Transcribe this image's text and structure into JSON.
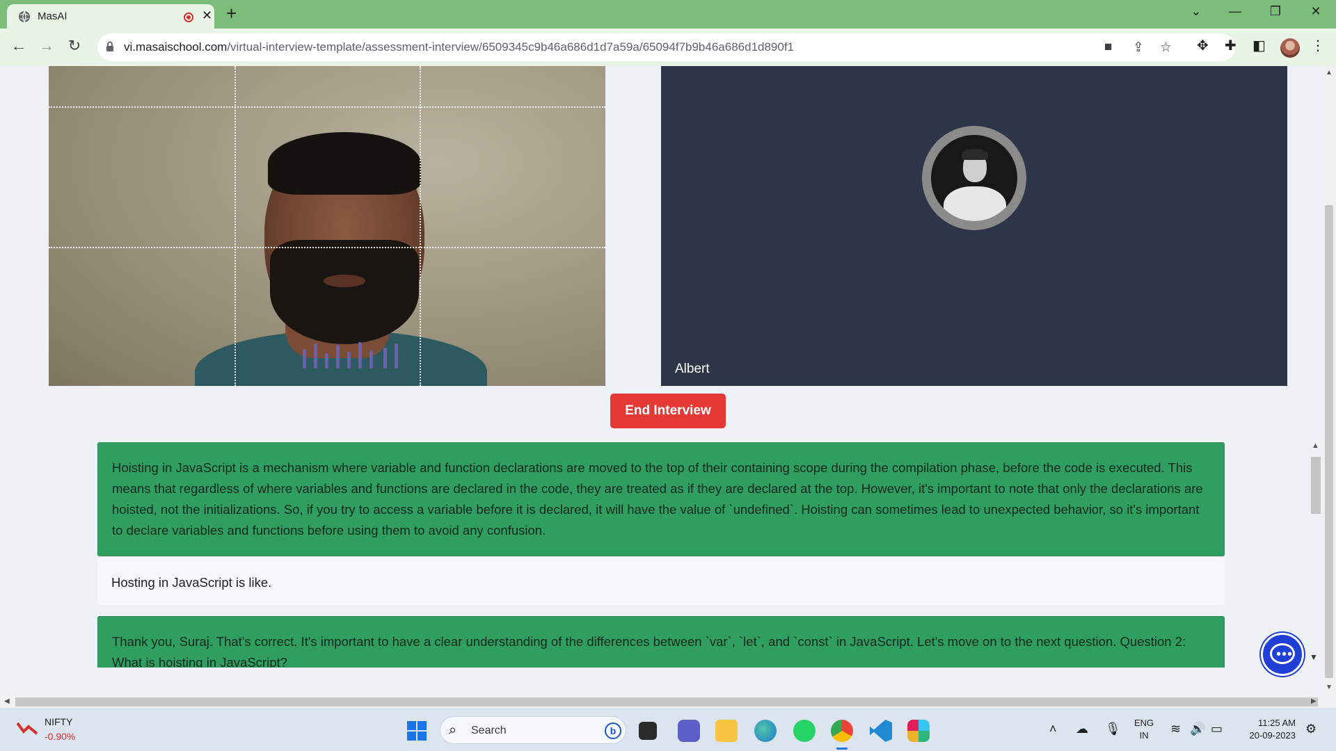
{
  "browser": {
    "tab_title": "MasAI",
    "tab_close": "✕",
    "new_tab": "+",
    "url_host": "vi.masaischool.com",
    "url_path": "/virtual-interview-template/assessment-interview/6509345c9b46a686d1d7a59a/65094f7b9b46a686d1d890f1",
    "icons": [
      "back-icon",
      "forward-icon",
      "reload-icon",
      "lock-icon",
      "camera-icon",
      "share-icon",
      "star-icon",
      "extension-icon",
      "puzzle-icon",
      "sidepanel-icon",
      "menu-icon"
    ],
    "window_controls": {
      "dropdown": "⌄",
      "minimize": "—",
      "restore": "❐",
      "close": "✕"
    }
  },
  "interview": {
    "interviewer_name": "Albert",
    "end_button_label": "End Interview",
    "messages": [
      {
        "role": "ai",
        "text": "Hoisting in JavaScript is a mechanism where variable and function declarations are moved to the top of their containing scope during the compilation phase, before the code is executed. This means that regardless of where variables and functions are declared in the code, they are treated as if they are declared at the top. However, it's important to note that only the declarations are hoisted, not the initializations. So, if you try to access a variable before it is declared, it will have the value of `undefined`. Hoisting can sometimes lead to unexpected behavior, so it's important to declare variables and functions before using them to avoid any confusion."
      },
      {
        "role": "user",
        "text": "Hosting in JavaScript is like."
      },
      {
        "role": "ai",
        "text": "Thank you, Suraj. That's correct. It's important to have a clear understanding of the differences between `var`, `let`, and `const` in JavaScript. Let's move on to the next question. Question 2: What is hoisting in JavaScript?"
      }
    ],
    "colors": {
      "ai_bubble": "#2f9e60",
      "end_button": "#e53935",
      "interviewer_panel": "#2e3548"
    }
  },
  "taskbar": {
    "stock_name": "NIFTY",
    "stock_change": "-0.90%",
    "search_label": "Search",
    "lang_line1": "ENG",
    "lang_line2": "IN",
    "time": "11:25 AM",
    "date": "20-09-2023"
  }
}
